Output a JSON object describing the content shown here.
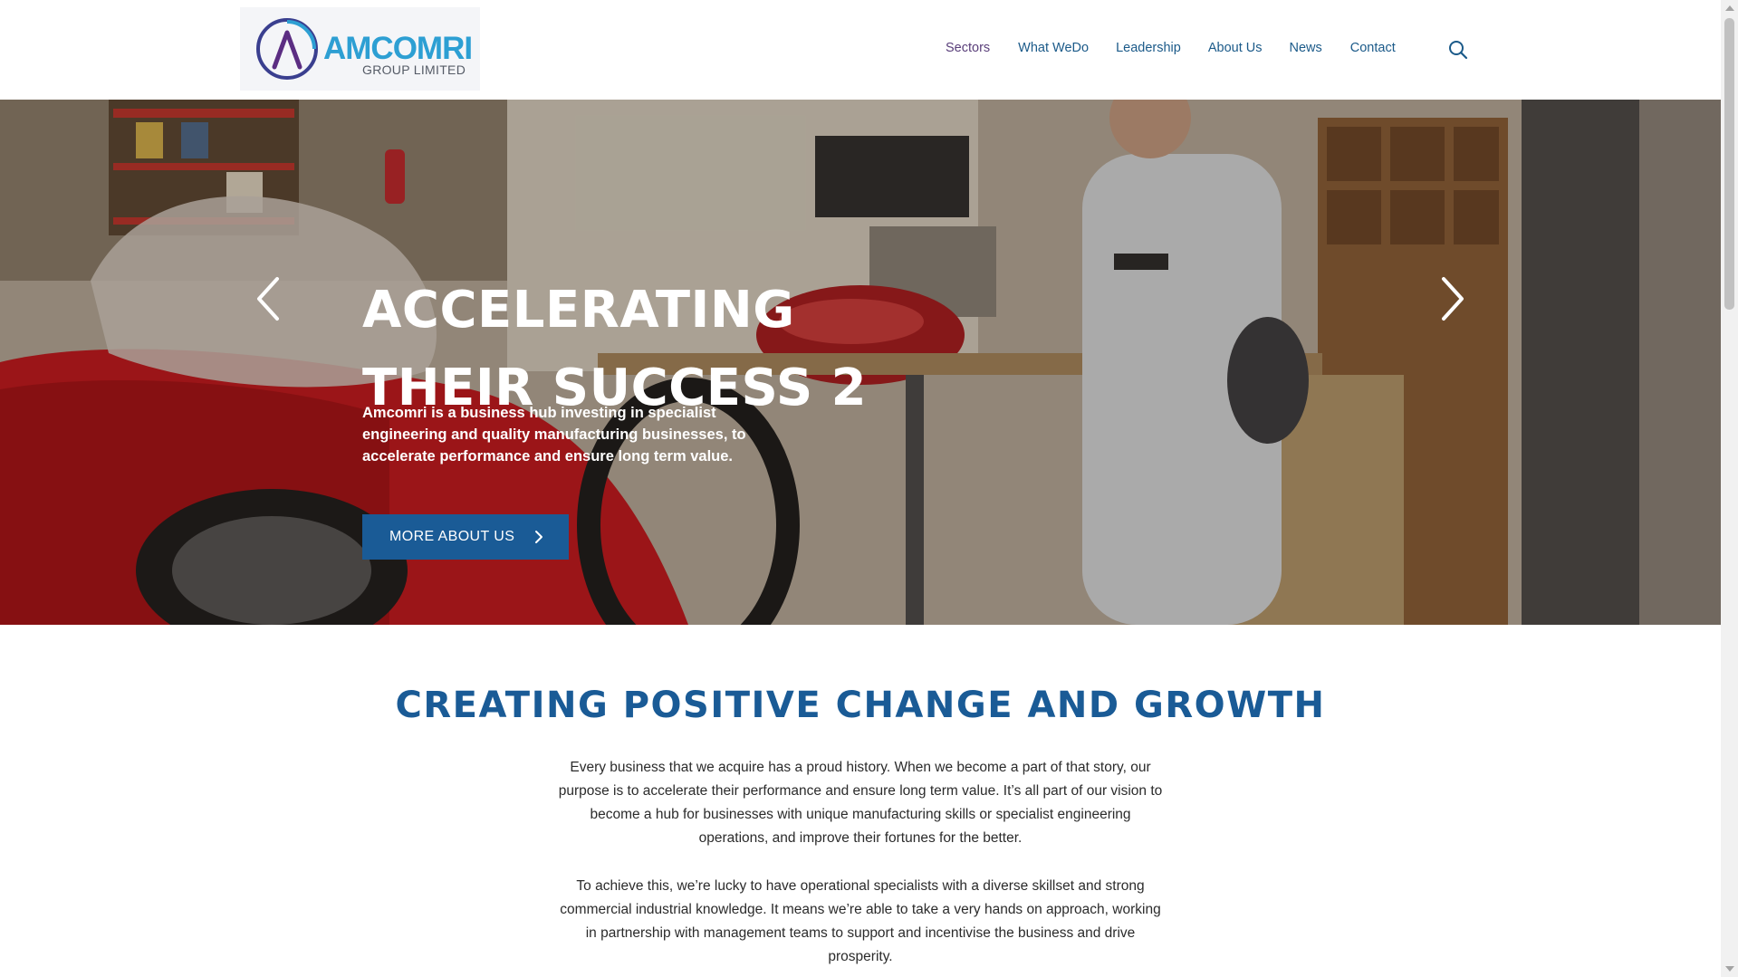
{
  "logo": {
    "name": "AMCOMRI",
    "sub": "GROUP LIMITED"
  },
  "nav": {
    "items": [
      {
        "label": "Sectors"
      },
      {
        "label": "What WeDo"
      },
      {
        "label": "Leadership"
      },
      {
        "label": "About Us"
      },
      {
        "label": "News"
      },
      {
        "label": "Contact"
      }
    ]
  },
  "icons": {
    "search": "search-icon",
    "prev": "chevron-left-icon",
    "next": "chevron-right-icon",
    "button": "chevron-right-icon"
  },
  "hero": {
    "title_line1": "ACCELERATING",
    "title_line2": "THEIR SUCCESS 2",
    "text": "Amcomri is a business hub investing in specialist engineering and quality manufacturing businesses, to accelerate performance and ensure long term value.",
    "button_label": "MORE ABOUT US"
  },
  "intro": {
    "title": "CREATING POSITIVE CHANGE AND GROWTH",
    "paragraph1": "Every business that we acquire has a proud history. When we become a part of that story, our purpose is to accelerate their performance and ensure long term value. It’s all part of our vision to become a hub for businesses with unique manufacturing skills or specialist engineering operations, and improve their fortunes for the better.",
    "paragraph2": "To achieve this, we’re lucky to have operational specialists with a diverse skillset and strong commercial industrial knowledge. It means we’re able to take a very hands on approach, working in partnership with management teams to support and incentivise the business and drive prosperity."
  },
  "colors": {
    "brand_blue": "#1a5b96",
    "logo_blue": "#2d9fd3",
    "logo_purple": "#5b2d82",
    "nav_text": "#1b5a89"
  }
}
